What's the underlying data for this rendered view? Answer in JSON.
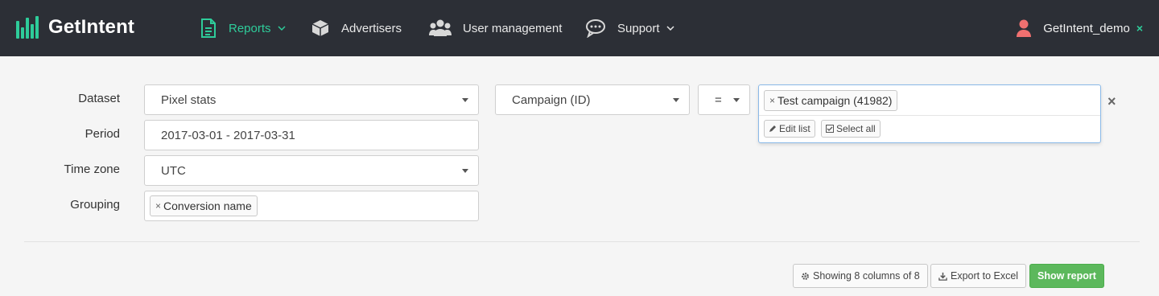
{
  "brand": {
    "name": "GetIntent",
    "accent": "#2ecc9a",
    "nav_bg": "#2c2f36"
  },
  "nav": {
    "reports": "Reports",
    "advertisers": "Advertisers",
    "user_management": "User management",
    "support": "Support"
  },
  "user": {
    "name": "GetIntent_demo",
    "logout_icon": "×"
  },
  "form": {
    "dataset_label": "Dataset",
    "dataset_value": "Pixel stats",
    "period_label": "Period",
    "period_value": "2017-03-01 - 2017-03-31",
    "timezone_label": "Time zone",
    "timezone_value": "UTC",
    "grouping_label": "Grouping",
    "grouping_tags": [
      "Conversion name"
    ]
  },
  "filter": {
    "field": "Campaign (ID)",
    "operator": "=",
    "values": [
      "Test campaign (41982)"
    ],
    "edit_list": "Edit list",
    "select_all": "Select all",
    "remove_icon": "×"
  },
  "actions": {
    "columns": "Showing 8 columns of 8",
    "export": "Export to Excel",
    "show_report": "Show report"
  }
}
